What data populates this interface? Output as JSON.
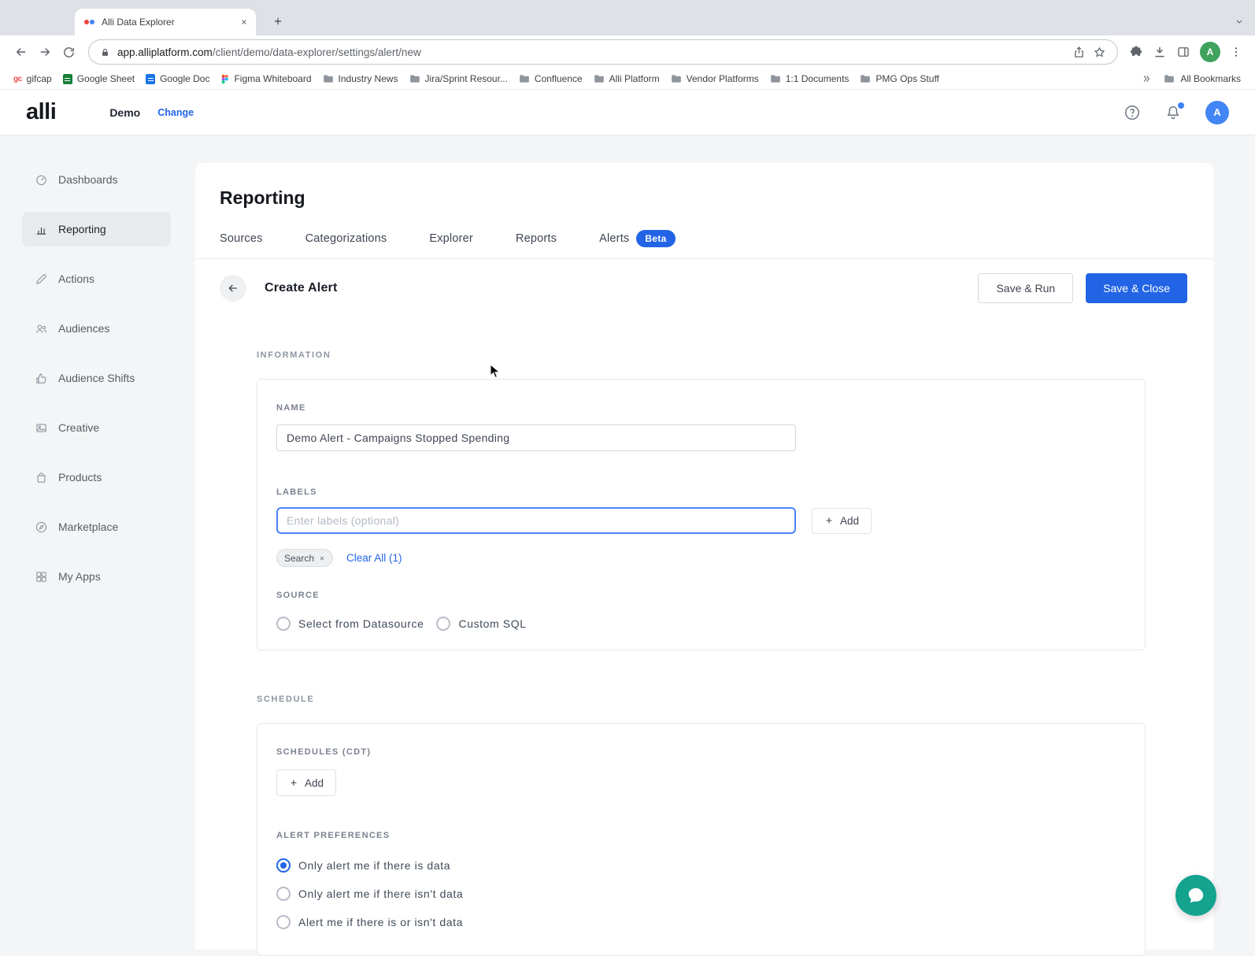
{
  "browser": {
    "tab_title": "Alli Data Explorer",
    "url_domain": "app.alliplatform.com",
    "url_path": "/client/demo/data-explorer/settings/alert/new",
    "bookmarks": [
      {
        "label": "gifcap",
        "icon_text": "gc"
      },
      {
        "label": "Google Sheet"
      },
      {
        "label": "Google Doc"
      },
      {
        "label": "Figma Whiteboard"
      },
      {
        "label": "Industry News"
      },
      {
        "label": "Jira/Sprint Resour..."
      },
      {
        "label": "Confluence"
      },
      {
        "label": "Alli Platform"
      },
      {
        "label": "Vendor Platforms"
      },
      {
        "label": "1:1 Documents"
      },
      {
        "label": "PMG Ops Stuff"
      }
    ],
    "all_bookmarks_label": "All Bookmarks",
    "profile_initial": "A"
  },
  "app_header": {
    "logo": "alli",
    "client_name": "Demo",
    "change_label": "Change",
    "avatar_initial": "A"
  },
  "sidebar": {
    "items": [
      {
        "label": "Dashboards"
      },
      {
        "label": "Reporting"
      },
      {
        "label": "Actions"
      },
      {
        "label": "Audiences"
      },
      {
        "label": "Audience Shifts"
      },
      {
        "label": "Creative"
      },
      {
        "label": "Products"
      },
      {
        "label": "Marketplace"
      },
      {
        "label": "My Apps"
      }
    ]
  },
  "main": {
    "page_title": "Reporting",
    "tabs": [
      {
        "label": "Sources"
      },
      {
        "label": "Categorizations"
      },
      {
        "label": "Explorer"
      },
      {
        "label": "Reports"
      },
      {
        "label": "Alerts",
        "badge": "Beta"
      }
    ]
  },
  "create_alert": {
    "title": "Create Alert",
    "save_run_label": "Save & Run",
    "save_close_label": "Save & Close",
    "information_section_label": "INFORMATION",
    "name_label": "NAME",
    "name_value": "Demo Alert - Campaigns Stopped Spending",
    "labels_label": "LABELS",
    "labels_placeholder": "Enter labels (optional)",
    "labels_add_label": "Add",
    "label_chip": "Search",
    "clear_all_label": "Clear All (1)",
    "source_label": "SOURCE",
    "source_options": [
      {
        "label": "Select from Datasource",
        "selected": false
      },
      {
        "label": "Custom SQL",
        "selected": false
      }
    ],
    "schedule_section_label": "SCHEDULE",
    "schedules_label": "SCHEDULES (CDT)",
    "schedules_add_label": "Add",
    "alert_preferences_label": "ALERT PREFERENCES",
    "preferences": [
      {
        "label": "Only alert me if there is data",
        "selected": true
      },
      {
        "label": "Only alert me if there isn't data",
        "selected": false
      },
      {
        "label": "Alert me if there is or isn't data",
        "selected": false
      }
    ]
  },
  "colors": {
    "accent_blue": "#2264e5",
    "beta_badge": "#2264e5",
    "chat_fab": "#14a38f"
  }
}
